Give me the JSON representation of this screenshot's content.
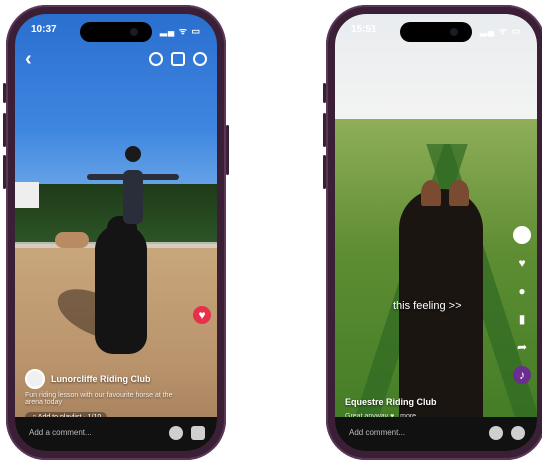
{
  "phones": [
    {
      "status": {
        "time": "10:37",
        "icons": "▂▄ ᯤ ▭"
      },
      "top_icons": [
        "search-icon",
        "camera-icon",
        "settings-icon"
      ],
      "caption": {
        "user": "Lunorcliffe Riding Club",
        "desc": "Fun riding lesson with our favourite horse at the arena today",
        "pill": "♫ Add to playlist · 1/10"
      },
      "right_rail": [
        "like-icon"
      ],
      "comment_placeholder": "Add a comment..."
    },
    {
      "status": {
        "time": "15:51",
        "icons": "▂▄ ᯤ ▭"
      },
      "overlay_text": "this feeling >>",
      "caption": {
        "user": "Equestre Riding Club",
        "desc": "Great anyway ♥ ..more"
      },
      "right_rail": [
        "avatar-icon",
        "heart-icon",
        "comment-icon",
        "bookmark-icon",
        "share-icon",
        "sound-icon"
      ],
      "comment_placeholder": "Add comment..."
    }
  ]
}
